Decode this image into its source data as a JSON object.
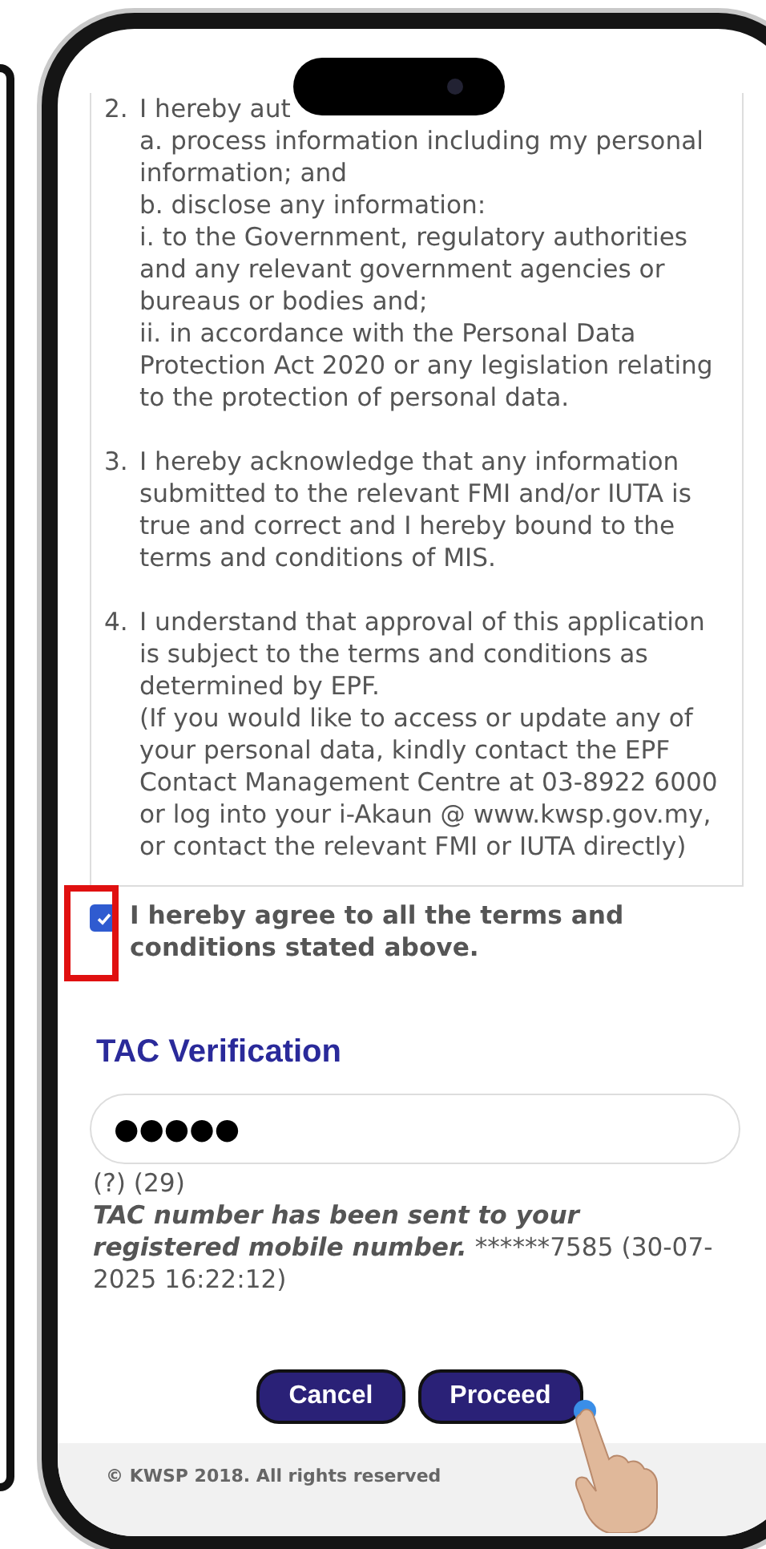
{
  "terms": [
    {
      "number": "2.",
      "lines": [
        "I hereby aut",
        "a. process information including my personal information; and",
        "b. disclose any information:",
        "i. to the Government, regulatory authorities and any relevant government agencies or bureaus or bodies and;",
        "ii. in accordance with the Personal Data Protection Act 2020 or any legislation relating to the protection of personal data."
      ]
    },
    {
      "number": "3.",
      "lines": [
        "I hereby acknowledge that any information submitted to the relevant FMI and/or IUTA is true and correct and I hereby bound to the terms and conditions of MIS."
      ]
    },
    {
      "number": "4.",
      "lines": [
        "I understand that approval of this application is subject to the terms and conditions as determined by EPF.",
        "(If you would like to access or update any of your personal data, kindly contact the EPF Contact Management Centre at 03-8922 6000 or log into your i-Akaun @ www.kwsp.gov.my, or contact the relevant FMI or IUTA directly)"
      ]
    }
  ],
  "agree": {
    "checked": true,
    "label": "I hereby agree to all the terms and conditions stated above."
  },
  "tac": {
    "heading": "TAC Verification",
    "value": "●●●●●",
    "hint": "(?) (29)",
    "message": "TAC number has been sent to your registered mobile number.",
    "detail": "******7585 (30-07-2025 16:22:12)"
  },
  "buttons": [
    {
      "label": "Cancel"
    },
    {
      "label": "Proceed"
    }
  ],
  "footer": "© KWSP 2018. All rights reserved"
}
